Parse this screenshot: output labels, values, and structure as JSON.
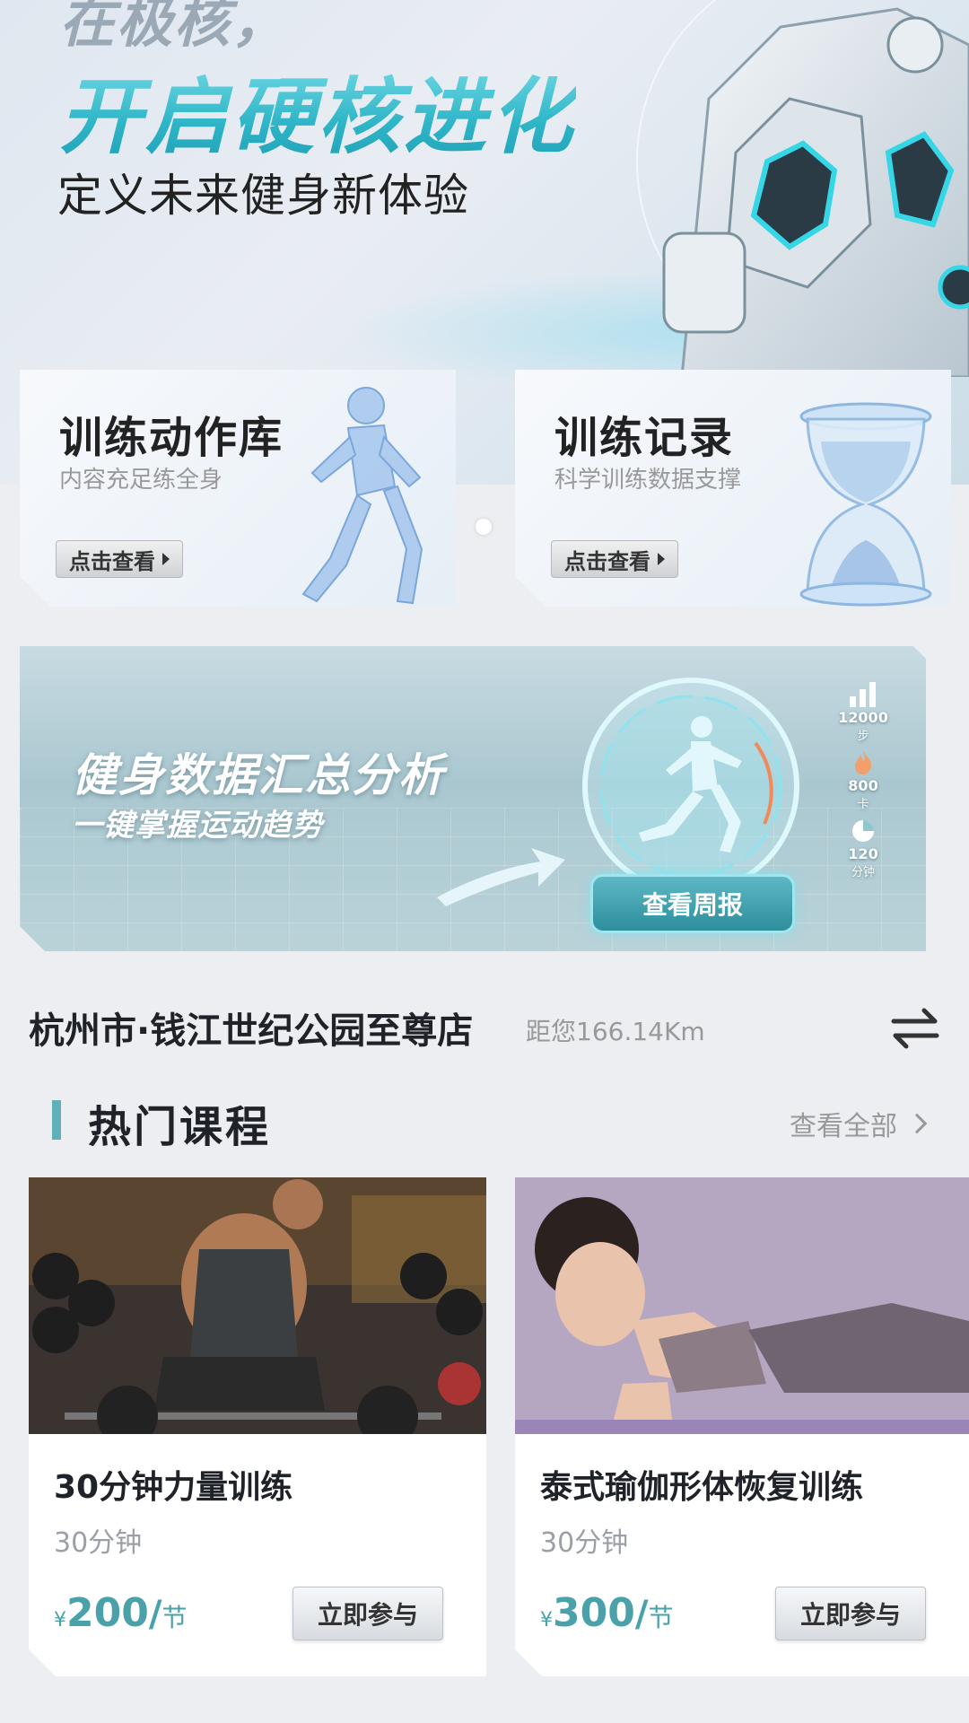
{
  "hero": {
    "top_text": "在极核，",
    "title": "开启硬核进化",
    "subtitle": "定义未来健身新体验"
  },
  "features": [
    {
      "title": "训练动作库",
      "subtitle": "内容充足练全身",
      "button": "点击查看"
    },
    {
      "title": "训练记录",
      "subtitle": "科学训练数据支撑",
      "button": "点击查看"
    }
  ],
  "data_banner": {
    "title": "健身数据汇总分析",
    "subtitle": "一键掌握运动趋势",
    "button": "查看周报",
    "stats": [
      {
        "value": "12000",
        "unit": "步",
        "icon": "bar-chart-icon"
      },
      {
        "value": "800",
        "unit": "卡",
        "icon": "flame-icon"
      },
      {
        "value": "120",
        "unit": "分钟",
        "icon": "pie-chart-icon"
      }
    ]
  },
  "store": {
    "name": "杭州市·钱江世纪公园至尊店",
    "distance": "距您166.14Km",
    "switch_icon": "swap-icon"
  },
  "hot_courses": {
    "title": "热门课程",
    "see_all": "查看全部",
    "courses": [
      {
        "name": "30分钟力量训练",
        "duration": "30分钟",
        "currency": "¥",
        "price": "200",
        "unit": "节",
        "button": "立即参与"
      },
      {
        "name": "泰式瑜伽形体恢复训练",
        "duration": "30分钟",
        "currency": "¥",
        "price": "300",
        "unit": "节",
        "button": "立即参与"
      }
    ]
  },
  "colors": {
    "accent": "#4aa1aa",
    "bar": "#5fb0b8",
    "hero_title": "#44c6d4"
  }
}
